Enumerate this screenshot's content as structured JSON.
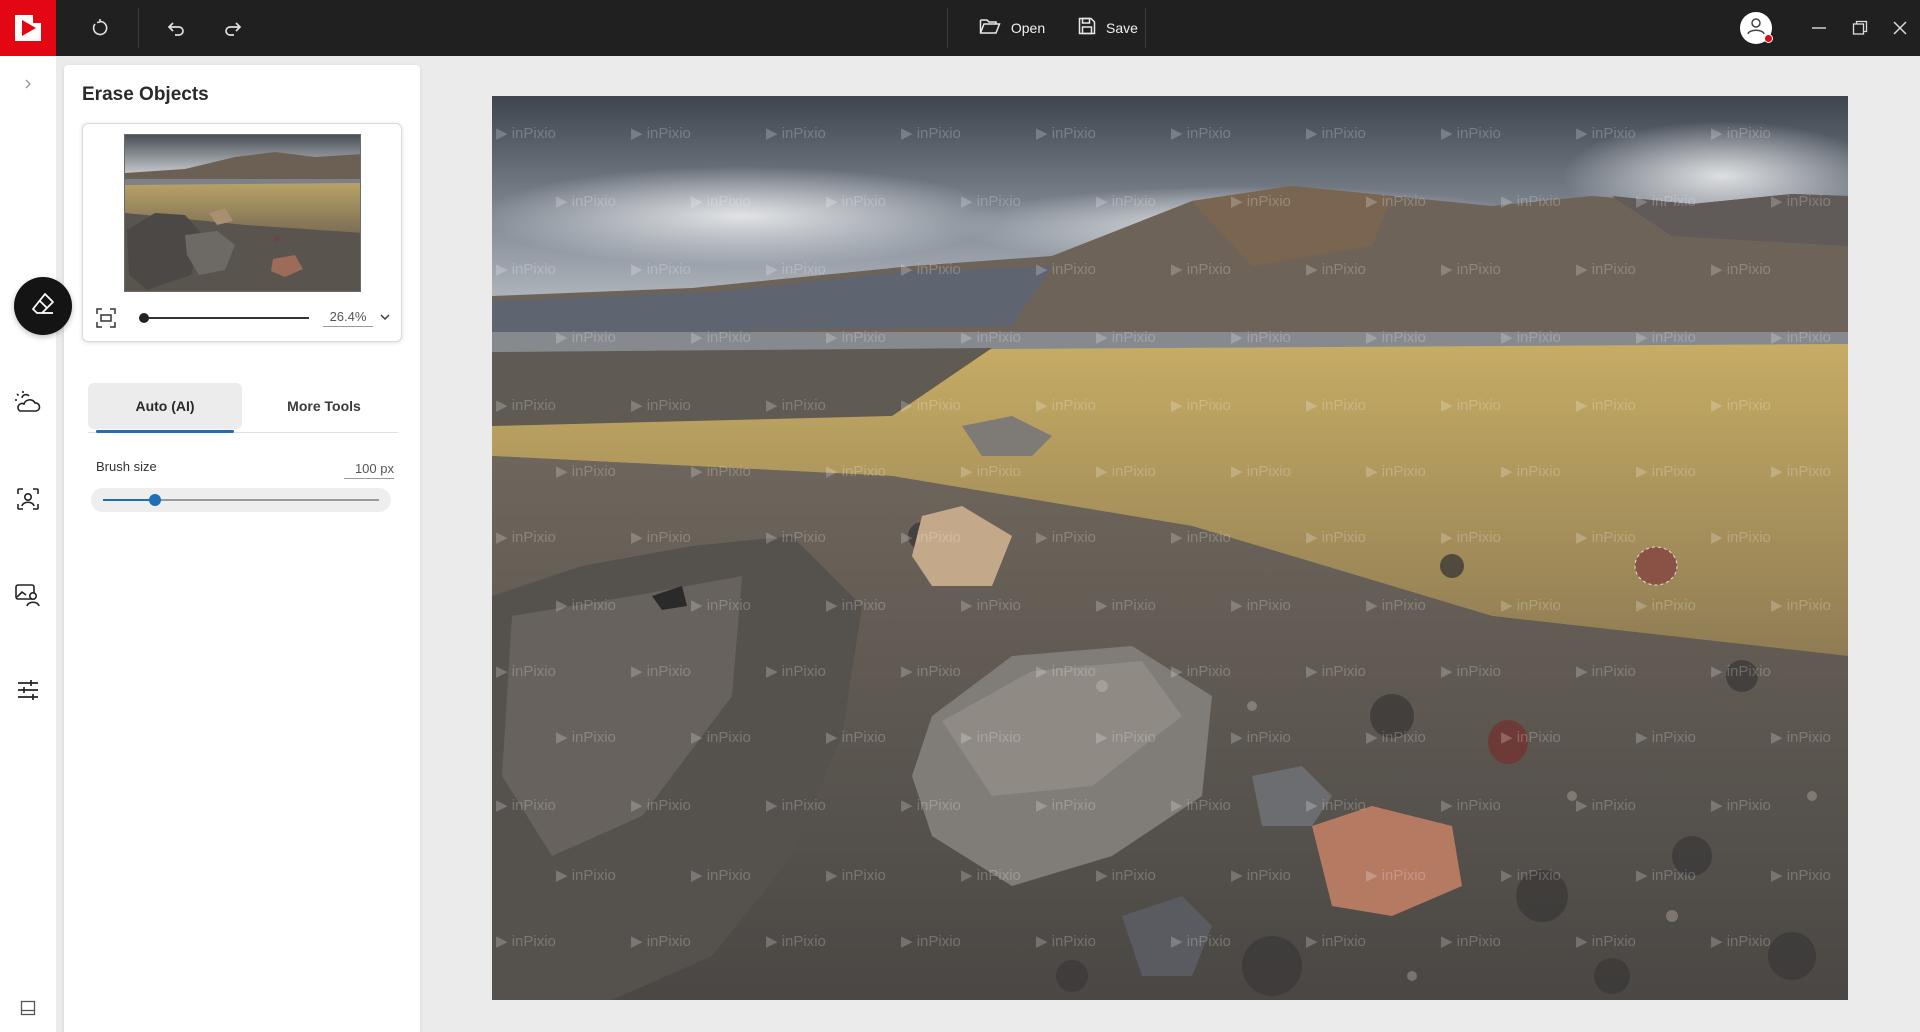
{
  "toolbar": {
    "open_label": "Open",
    "save_label": "Save",
    "brand_color": "#e30613",
    "background_color": "#202020",
    "icons": [
      "logo-icon",
      "reset-icon",
      "undo-icon",
      "redo-icon",
      "folder-open-icon",
      "save-icon",
      "user-icon",
      "minimize-icon",
      "restore-icon",
      "close-icon"
    ]
  },
  "rail": {
    "items": [
      "expand-chevron-icon",
      "eraser-icon",
      "weather-sky-icon",
      "portrait-icon",
      "background-replace-icon",
      "adjustments-icon",
      "bottom-panel-icon"
    ],
    "active": "eraser-icon"
  },
  "panel": {
    "title": "Erase Objects",
    "zoom_value": "26.4%",
    "zoom_fraction": 0.02,
    "tabs": [
      {
        "label": "Auto (AI)",
        "active": true
      },
      {
        "label": "More Tools",
        "active": false
      }
    ],
    "brush": {
      "label": "Brush size",
      "value": "100 px",
      "fraction": 0.19
    },
    "accent_color": "#1e6fb7"
  },
  "canvas": {
    "watermark": "inPixio"
  }
}
